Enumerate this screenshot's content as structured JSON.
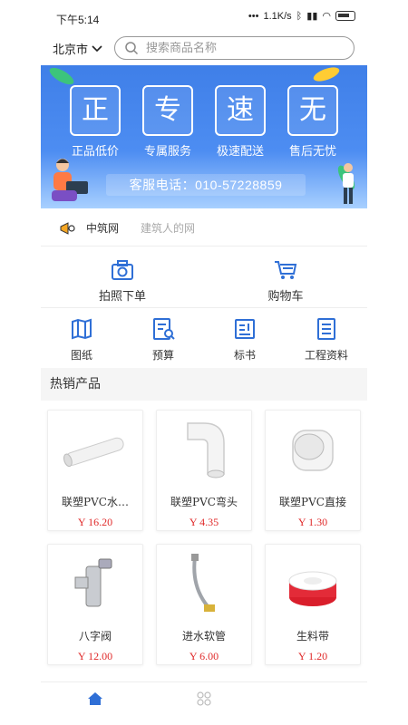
{
  "status_bar": {
    "time": "下午5:14",
    "net_speed": "1.1K/s"
  },
  "location": {
    "city": "北京市"
  },
  "search": {
    "placeholder": "搜索商品名称"
  },
  "banner": {
    "tiles": [
      {
        "char": "正",
        "caption": "正品低价"
      },
      {
        "char": "专",
        "caption": "专属服务"
      },
      {
        "char": "速",
        "caption": "极速配送"
      },
      {
        "char": "无",
        "caption": "售后无忧"
      }
    ],
    "hotline": "客服电话：010-57228859"
  },
  "brand": {
    "name": "中筑网",
    "slogan": "建筑人的网"
  },
  "quick_actions": [
    {
      "label": "拍照下单",
      "icon": "camera-icon"
    },
    {
      "label": "购物车",
      "icon": "cart-icon"
    }
  ],
  "categories": [
    {
      "label": "图纸",
      "icon": "map-icon"
    },
    {
      "label": "预算",
      "icon": "budget-icon"
    },
    {
      "label": "标书",
      "icon": "bid-icon"
    },
    {
      "label": "工程资料",
      "icon": "document-icon"
    }
  ],
  "hot_products": {
    "title": "热销产品",
    "items": [
      {
        "name": "联塑PVC水…",
        "price": "Y 16.20"
      },
      {
        "name": "联塑PVC弯头",
        "price": "Y 4.35"
      },
      {
        "name": "联塑PVC直接",
        "price": "Y 1.30"
      },
      {
        "name": "八字阀",
        "price": "Y 12.00"
      },
      {
        "name": "进水软管",
        "price": "Y 6.00"
      },
      {
        "name": "生料带",
        "price": "Y 1.20"
      }
    ]
  },
  "colors": {
    "accent": "#3f7fe8",
    "price": "#e02a2a",
    "tab_active": "#2f6fd6"
  }
}
